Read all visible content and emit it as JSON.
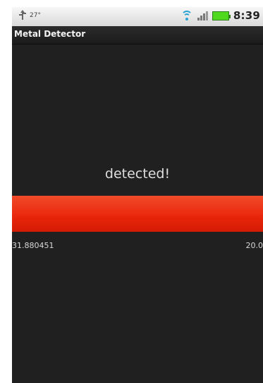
{
  "status_bar": {
    "temperature": "27°",
    "time": "8:39",
    "icons": {
      "usb": "usb-icon",
      "wifi": "wifi-icon",
      "signal": "signal-icon",
      "battery": "battery-icon"
    },
    "colors": {
      "wifi": "#2aa0d4",
      "battery": "#4fd81d"
    }
  },
  "app": {
    "title": "Metal Detector"
  },
  "detector": {
    "status_text": "detected!",
    "meter_level": 1.0,
    "meter_color": "#ec2d10",
    "current_reading": "31.880451",
    "threshold": "20.0"
  }
}
